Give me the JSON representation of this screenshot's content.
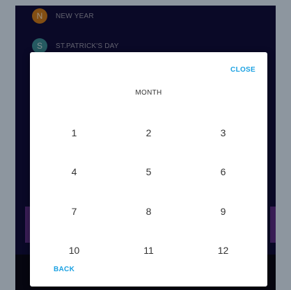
{
  "list": {
    "items": [
      {
        "initial": "N",
        "label": "NEW YEAR",
        "color": "#c8781e"
      },
      {
        "initial": "S",
        "label": "ST.PATRICK'S DAY",
        "color": "#3a8a96"
      }
    ]
  },
  "dialog": {
    "close_label": "CLOSE",
    "title": "MONTH",
    "months": [
      "1",
      "2",
      "3",
      "4",
      "5",
      "6",
      "7",
      "8",
      "9",
      "10",
      "11",
      "12"
    ],
    "back_label": "BACK",
    "accent_color": "#1ba1e2"
  }
}
